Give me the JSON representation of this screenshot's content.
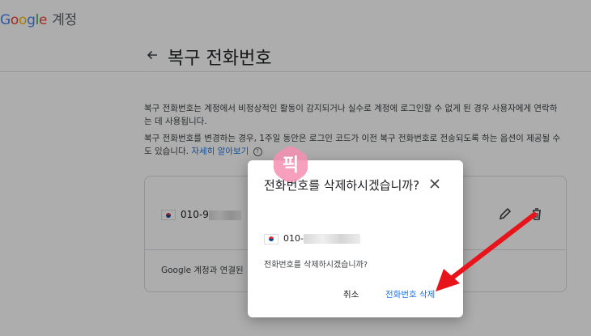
{
  "header": {
    "logo_letters": [
      "G",
      "o",
      "o",
      "g",
      "l",
      "e"
    ],
    "suffix": "계정"
  },
  "title": "복구 전화번호",
  "description": {
    "p1": "복구 전화번호는 계정에서 비정상적인 활동이 감지되거나 실수로 계정에 로그인할 수 없게 된 경우 사용자에게 연락하는 데 사용됩니다.",
    "p2": "복구 전화번호를 변경하는 경우, 1주일 동안은 로그인 코드가 이전 복구 전화번호로 전송되도록 하는 옵션이 제공될 수도 있습니다.",
    "link": "자세히 알아보기"
  },
  "card": {
    "phone_prefix": "010-9",
    "footer": "Google 계정과 연결된"
  },
  "dialog": {
    "title": "전화번호를 삭제하시겠습니까?",
    "phone_prefix": "010-",
    "message": "전화번호를 삭제하시겠습니까?",
    "cancel_label": "취소",
    "delete_label": "전화번호 삭제"
  },
  "watermark": {
    "text": "픽",
    "color": "#f06292"
  },
  "colors": {
    "accent": "#1a73e8",
    "arrow": "#e8141b"
  },
  "icons": {
    "back": "arrow-left-icon",
    "edit": "pencil-icon",
    "delete": "trash-icon",
    "close": "close-icon",
    "flag": "korea-flag-icon"
  }
}
